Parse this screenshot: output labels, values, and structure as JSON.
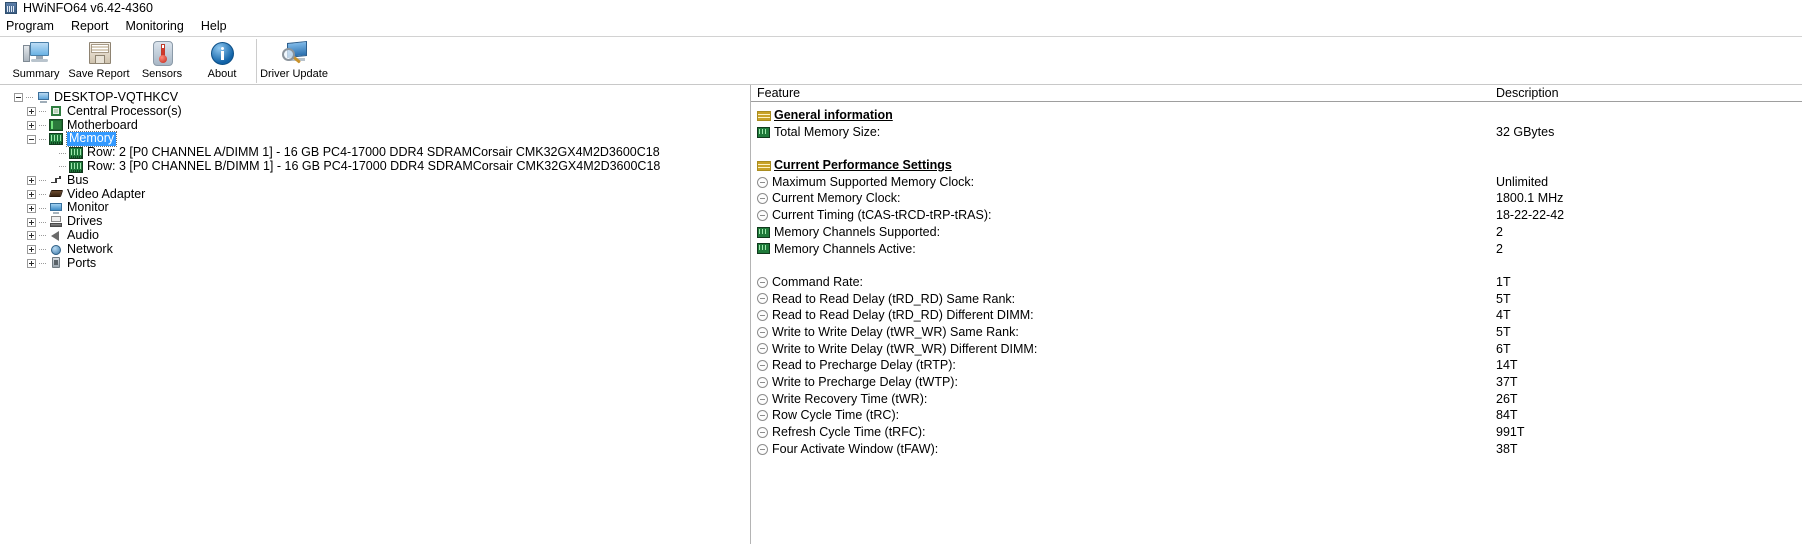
{
  "window": {
    "title": "HWiNFO64 v6.42-4360",
    "icon": "hwinfo-app-icon"
  },
  "menu": {
    "items": [
      {
        "label": "Program"
      },
      {
        "label": "Report"
      },
      {
        "label": "Monitoring"
      },
      {
        "label": "Help"
      }
    ]
  },
  "toolbar": {
    "buttons": [
      {
        "label": "Summary",
        "icon": "monitor-icon"
      },
      {
        "label": "Save Report",
        "icon": "floppy-disk-icon"
      },
      {
        "label": "Sensors",
        "icon": "thermometer-icon"
      },
      {
        "label": "About",
        "icon": "info-circle-icon"
      },
      {
        "label": "Driver Update",
        "icon": "driver-update-icon"
      }
    ]
  },
  "tree": {
    "nodes": [
      {
        "label": "DESKTOP-VQTHKCV",
        "icon": "computer-icon",
        "toggle": "minus",
        "depth": 0,
        "selected": false
      },
      {
        "label": "Central Processor(s)",
        "icon": "cpu-icon",
        "toggle": "plus",
        "depth": 1,
        "selected": false
      },
      {
        "label": "Motherboard",
        "icon": "motherboard-icon",
        "toggle": "plus",
        "depth": 1,
        "selected": false
      },
      {
        "label": "Memory",
        "icon": "memory-icon",
        "toggle": "minus",
        "depth": 1,
        "selected": true
      },
      {
        "label": "Row: 2 [P0 CHANNEL A/DIMM 1] - 16 GB PC4-17000 DDR4 SDRAMCorsair CMK32GX4M2D3600C18",
        "icon": "memory-icon",
        "toggle": "none",
        "depth": 2,
        "selected": false
      },
      {
        "label": "Row: 3 [P0 CHANNEL B/DIMM 1] - 16 GB PC4-17000 DDR4 SDRAMCorsair CMK32GX4M2D3600C18",
        "icon": "memory-icon",
        "toggle": "none",
        "depth": 2,
        "selected": false
      },
      {
        "label": "Bus",
        "icon": "bus-icon",
        "toggle": "plus",
        "depth": 1,
        "selected": false
      },
      {
        "label": "Video Adapter",
        "icon": "video-adapter-icon",
        "toggle": "plus",
        "depth": 1,
        "selected": false
      },
      {
        "label": "Monitor",
        "icon": "monitor-icon",
        "toggle": "plus",
        "depth": 1,
        "selected": false
      },
      {
        "label": "Drives",
        "icon": "drives-icon",
        "toggle": "plus",
        "depth": 1,
        "selected": false
      },
      {
        "label": "Audio",
        "icon": "audio-speaker-icon",
        "toggle": "plus",
        "depth": 1,
        "selected": false
      },
      {
        "label": "Network",
        "icon": "network-globe-icon",
        "toggle": "plus",
        "depth": 1,
        "selected": false
      },
      {
        "label": "Ports",
        "icon": "ports-icon",
        "toggle": "plus",
        "depth": 1,
        "selected": false
      }
    ]
  },
  "detail": {
    "columns": {
      "feature": "Feature",
      "description": "Description"
    },
    "rows": [
      {
        "kind": "section",
        "icon": "section-bars-icon",
        "feature": "General information",
        "value": ""
      },
      {
        "kind": "item",
        "icon": "memory-icon",
        "feature": "Total Memory Size:",
        "value": "32 GBytes"
      },
      {
        "kind": "spacer",
        "icon": "",
        "feature": "",
        "value": ""
      },
      {
        "kind": "section",
        "icon": "section-bars-icon",
        "feature": "Current Performance Settings",
        "value": ""
      },
      {
        "kind": "item",
        "icon": "minus-circle-icon",
        "feature": "Maximum Supported Memory Clock:",
        "value": "Unlimited"
      },
      {
        "kind": "item",
        "icon": "minus-circle-icon",
        "feature": "Current Memory Clock:",
        "value": "1800.1 MHz"
      },
      {
        "kind": "item",
        "icon": "minus-circle-icon",
        "feature": "Current Timing (tCAS-tRCD-tRP-tRAS):",
        "value": "18-22-22-42"
      },
      {
        "kind": "item",
        "icon": "memory-icon",
        "feature": "Memory Channels Supported:",
        "value": "2"
      },
      {
        "kind": "item",
        "icon": "memory-icon",
        "feature": "Memory Channels Active:",
        "value": "2"
      },
      {
        "kind": "spacer",
        "icon": "",
        "feature": "",
        "value": ""
      },
      {
        "kind": "item",
        "icon": "minus-circle-icon",
        "feature": "Command Rate:",
        "value": "1T"
      },
      {
        "kind": "item",
        "icon": "minus-circle-icon",
        "feature": "Read to Read Delay (tRD_RD) Same Rank:",
        "value": "5T"
      },
      {
        "kind": "item",
        "icon": "minus-circle-icon",
        "feature": "Read to Read Delay (tRD_RD) Different DIMM:",
        "value": "4T"
      },
      {
        "kind": "item",
        "icon": "minus-circle-icon",
        "feature": "Write to Write Delay (tWR_WR) Same Rank:",
        "value": "5T"
      },
      {
        "kind": "item",
        "icon": "minus-circle-icon",
        "feature": "Write to Write Delay (tWR_WR) Different DIMM:",
        "value": "6T"
      },
      {
        "kind": "item",
        "icon": "minus-circle-icon",
        "feature": "Read to Precharge Delay (tRTP):",
        "value": "14T"
      },
      {
        "kind": "item",
        "icon": "minus-circle-icon",
        "feature": "Write to Precharge Delay (tWTP):",
        "value": "37T"
      },
      {
        "kind": "item",
        "icon": "minus-circle-icon",
        "feature": "Write Recovery Time (tWR):",
        "value": "26T"
      },
      {
        "kind": "item",
        "icon": "minus-circle-icon",
        "feature": "Row Cycle Time (tRC):",
        "value": "84T"
      },
      {
        "kind": "item",
        "icon": "minus-circle-icon",
        "feature": "Refresh Cycle Time (tRFC):",
        "value": "991T"
      },
      {
        "kind": "item",
        "icon": "minus-circle-icon",
        "feature": "Four Activate Window (tFAW):",
        "value": "38T"
      }
    ]
  },
  "colors": {
    "selection": "#3399ff",
    "section_icon": "#c9a227",
    "memory_icon": "#1f7a3a",
    "pane_border": "#b4b4b4"
  }
}
